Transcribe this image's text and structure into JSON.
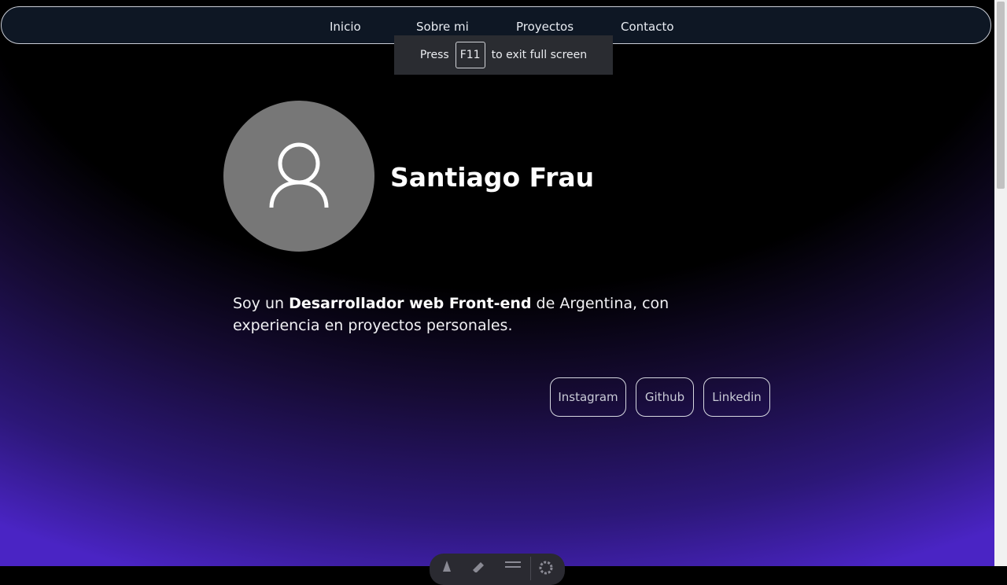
{
  "nav": {
    "items": [
      "Inicio",
      "Sobre mi",
      "Proyectos",
      "Contacto"
    ]
  },
  "fullscreen_notice": {
    "before": "Press",
    "key": "F11",
    "after": "to exit full screen"
  },
  "hero": {
    "avatar_icon": "user-icon",
    "name": "Santiago Frau"
  },
  "about": {
    "text_before": "Soy un ",
    "highlight": "Desarrollador web Front-end",
    "text_after": " de Argentina, con experiencia en proyectos personales."
  },
  "social": {
    "instagram": "Instagram",
    "github": "Github",
    "linkedin": "Linkedin"
  },
  "colors": {
    "navbar_bg": "#0e1724",
    "gradient_accent": "#4a24c4",
    "avatar_bg": "#777777"
  }
}
